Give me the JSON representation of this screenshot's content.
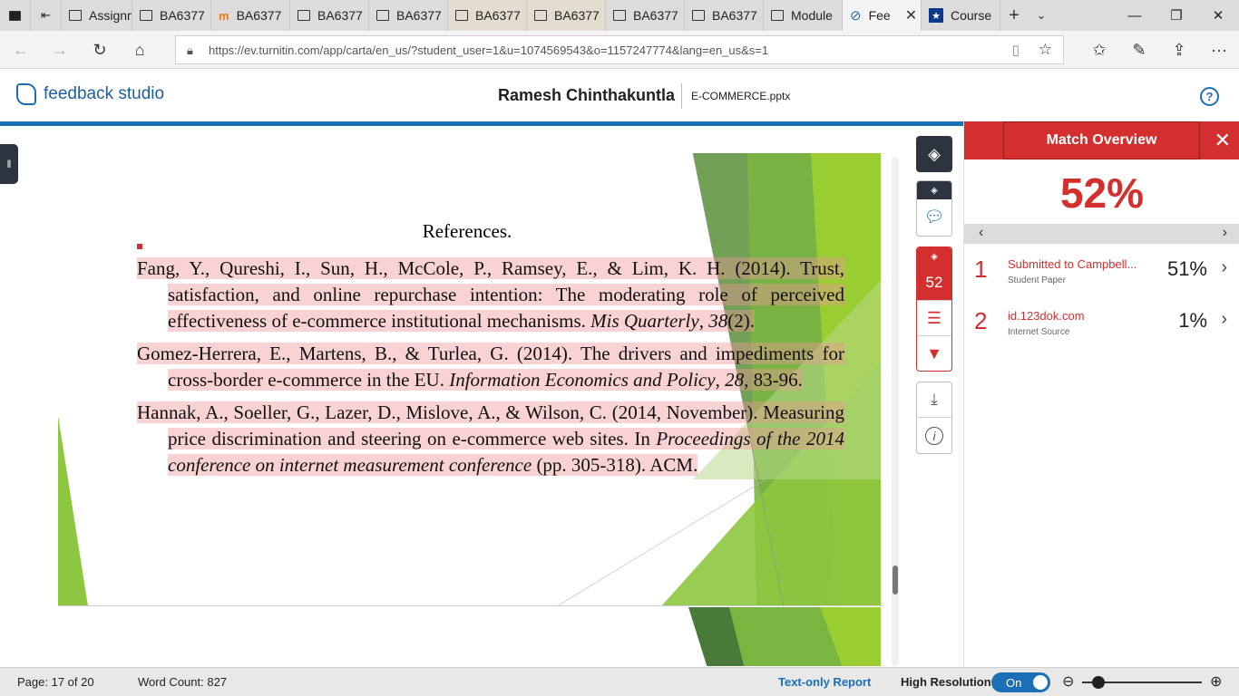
{
  "browser": {
    "tabs": [
      {
        "label": "",
        "icon": "tab-manager-icon"
      },
      {
        "label": "",
        "icon": "back-tab-icon"
      },
      {
        "label": "Assignm",
        "icon": "page-icon"
      },
      {
        "label": "BA6377",
        "icon": "page-icon"
      },
      {
        "label": "BA6377",
        "icon": "moodle-icon"
      },
      {
        "label": "BA6377",
        "icon": "page-icon"
      },
      {
        "label": "BA6377",
        "icon": "page-icon"
      },
      {
        "label": "BA6377",
        "icon": "page-icon"
      },
      {
        "label": "BA6377",
        "icon": "page-icon"
      },
      {
        "label": "BA6377",
        "icon": "page-icon"
      },
      {
        "label": "BA6377",
        "icon": "page-icon"
      },
      {
        "label": "Module",
        "icon": "page-icon"
      },
      {
        "label": "Fee",
        "icon": "turnitin-icon"
      },
      {
        "label": "Course",
        "icon": "star-badge-icon"
      }
    ],
    "url": "https://ev.turnitin.com/app/carta/en_us/?student_user=1&u=1074569543&o=1157247774&lang=en_us&s=1",
    "url_host": "ev.turnitin.com"
  },
  "app": {
    "brand": "feedback studio",
    "student_name": "Ramesh Chinthakuntla",
    "file_name": "E-COMMERCE.pptx"
  },
  "document": {
    "title": "References.",
    "references": [
      {
        "before": "Fang, Y., Qureshi, I., Sun, H., McCole, P., Ramsey, E., & Lim, K. H. (2014). Trust, satisfaction, and online repurchase intention: The moderating role of perceived effectiveness of e-commerce institutional mechanisms. ",
        "italic": "Mis Quarterly",
        "after": ", ",
        "italic2": "38",
        "after2": "(2)."
      },
      {
        "before": "Gomez-Herrera, E., Martens, B., & Turlea, G. (2014). The drivers and impediments for cross-border e-commerce in the EU. ",
        "italic": "Information Economics and Policy",
        "after": ", ",
        "italic2": "28",
        "after2": ", 83-96."
      },
      {
        "before": "Hannak, A., Soeller, G., Lazer, D., Mislove, A., & Wilson, C. (2014, November). Measuring price discrimination and steering on e-commerce web sites. In ",
        "italic": "Proceedings of the 2014 conference on internet measurement conference",
        "after": " (pp. 305-318). ACM.",
        "italic2": "",
        "after2": ""
      }
    ]
  },
  "toolbar": {
    "similarity_score": "52"
  },
  "match_panel": {
    "title": "Match Overview",
    "overall_percent": "52%",
    "matches": [
      {
        "index": "1",
        "source": "Submitted to Campbell...",
        "type": "Student Paper",
        "percent": "51%"
      },
      {
        "index": "2",
        "source": "id.123dok.com",
        "type": "Internet Source",
        "percent": "1%"
      }
    ]
  },
  "status_bar": {
    "page": "Page: 17 of 20",
    "word_count": "Word Count: 827",
    "text_only": "Text-only Report",
    "high_res_label": "High Resolution",
    "toggle_state": "On",
    "zoom_level": 0.14
  },
  "colors": {
    "accent_blue": "#1b6fb5",
    "match_red": "#d32f2f",
    "toolbar_dark": "#2d3440"
  }
}
